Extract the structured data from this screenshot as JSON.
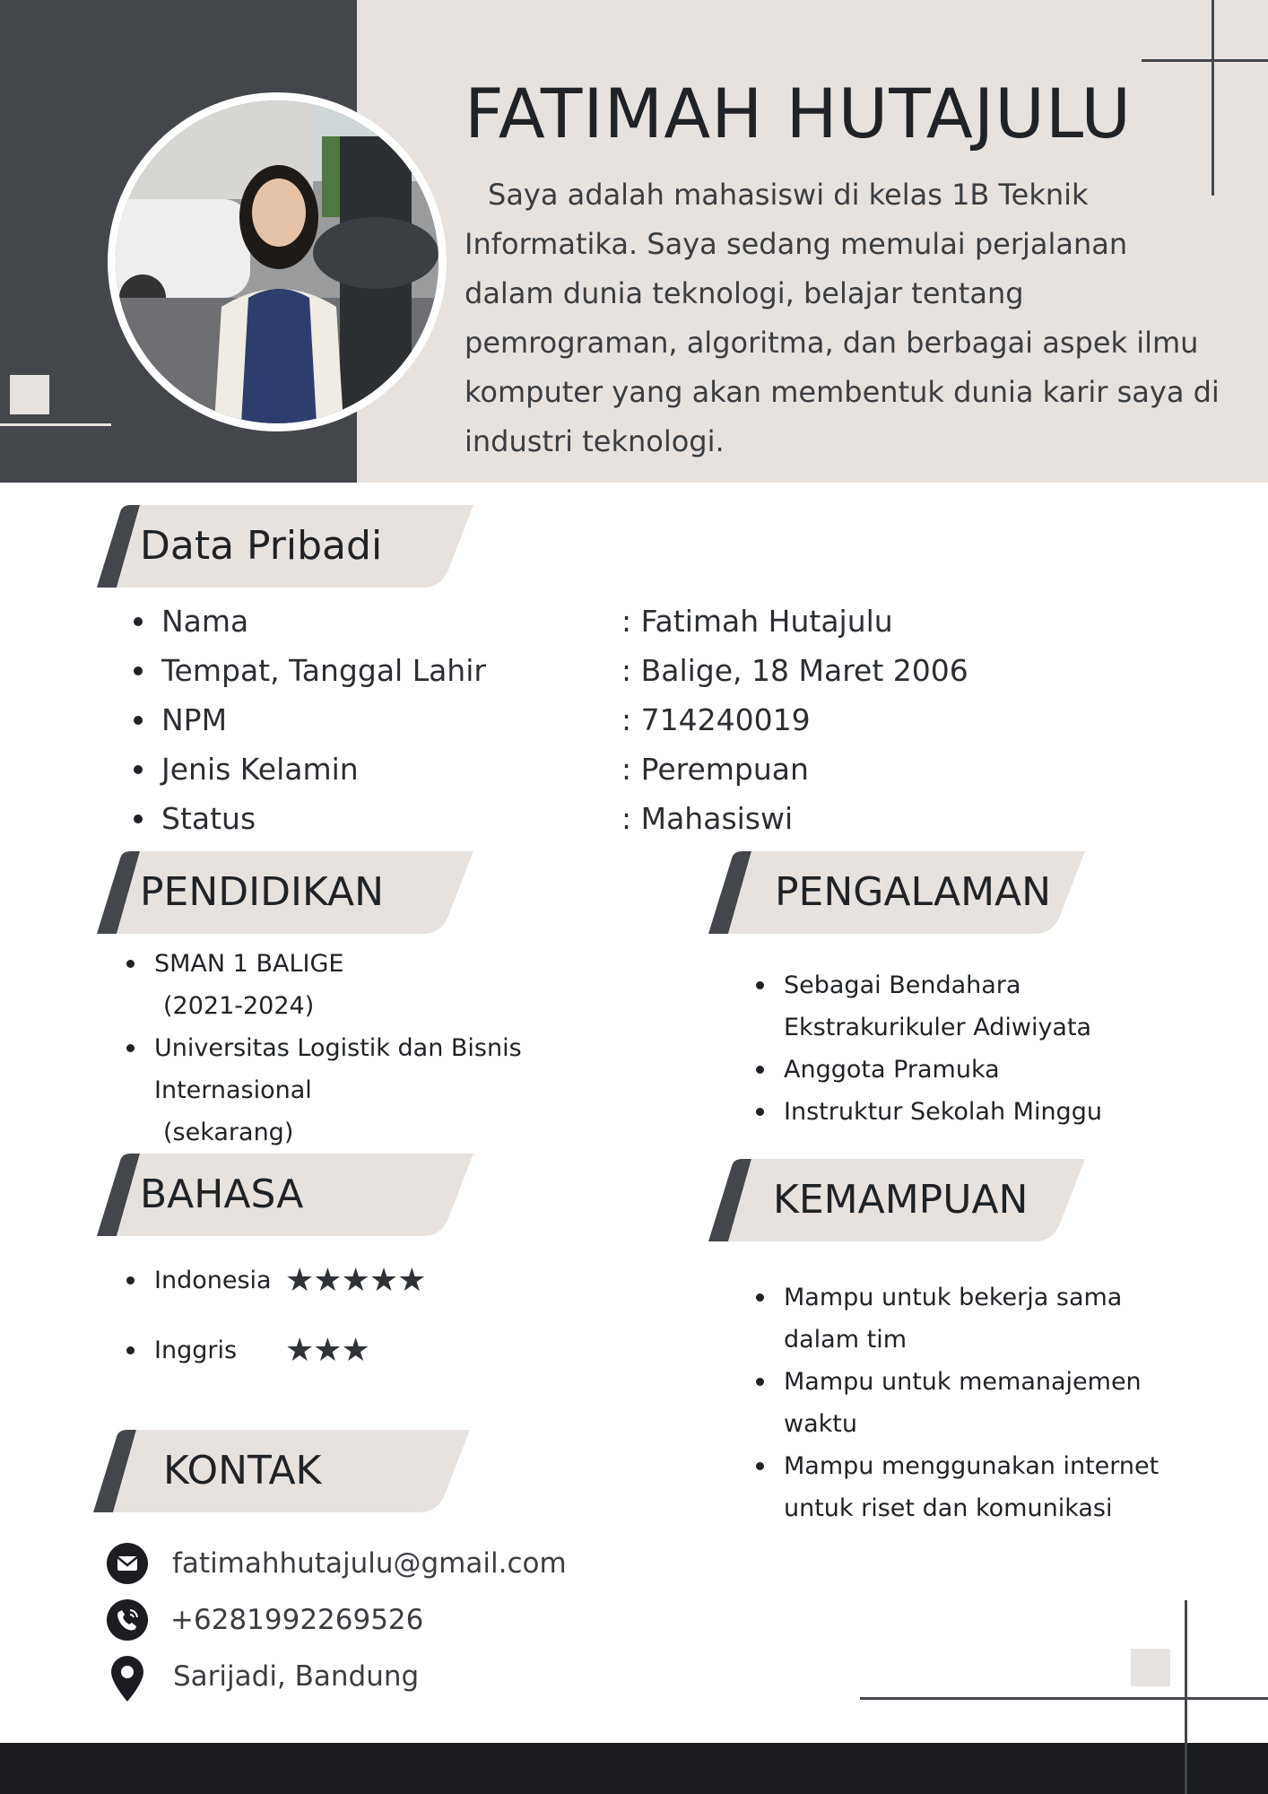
{
  "header": {
    "name": "FATIMAH HUTAJULU",
    "bio": "Saya adalah mahasiswi di kelas 1B Teknik Informatika. Saya sedang memulai perjalanan dalam dunia teknologi, belajar tentang pemrograman, algoritma, dan berbagai aspek ilmu komputer yang akan membentuk dunia karir saya di industri teknologi."
  },
  "personal": {
    "title": "Data Pribadi",
    "rows": [
      {
        "label": "Nama",
        "value": ": Fatimah Hutajulu"
      },
      {
        "label": "Tempat, Tanggal Lahir",
        "value": ": Balige, 18 Maret 2006"
      },
      {
        "label": "NPM",
        "value": ": 714240019"
      },
      {
        "label": "Jenis Kelamin",
        "value": ": Perempuan"
      },
      {
        "label": "Status",
        "value": ": Mahasiswi"
      }
    ]
  },
  "education": {
    "title": "PENDIDIKAN",
    "items": [
      {
        "line1": "SMAN 1 BALIGE",
        "line2": "(2021-2024)"
      },
      {
        "line1": "Universitas Logistik dan Bisnis",
        "line1b": "Internasional",
        "line2": "(sekarang)"
      }
    ]
  },
  "experience": {
    "title": "PENGALAMAN",
    "items": [
      "Sebagai Bendahara Ekstrakurikuler Adiwiyata",
      "Anggota Pramuka",
      "Instruktur Sekolah Minggu"
    ]
  },
  "languages": {
    "title": "BAHASA",
    "items": [
      {
        "name": "Indonesia",
        "rating": 5,
        "stars": "★★★★★"
      },
      {
        "name": "Inggris",
        "rating": 3,
        "stars": "★★★"
      }
    ]
  },
  "skills": {
    "title": "KEMAMPUAN",
    "items": [
      "Mampu untuk bekerja sama dalam tim",
      "Mampu untuk memanajemen waktu",
      "Mampu menggunakan internet untuk riset dan komunikasi"
    ]
  },
  "contact": {
    "title": "KONTAK",
    "email": "fatimahhutajulu@gmail.com",
    "phone": "+6281992269526",
    "location": "Sarijadi, Bandung"
  },
  "colors": {
    "dark": "#43464b",
    "beige": "#e7e2dd",
    "footer": "#1b1d22"
  }
}
